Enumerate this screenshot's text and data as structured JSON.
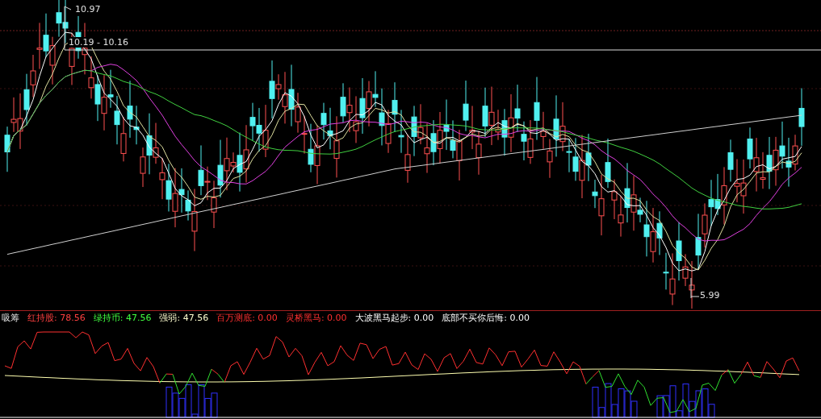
{
  "price_labels": [
    {
      "text": "10.97"
    },
    {
      "text": "10.19 - 10.16"
    },
    {
      "text": "5.99"
    }
  ],
  "indicator": {
    "title": "吸筹",
    "items": [
      {
        "label": "红持股:",
        "value": "78.56",
        "color": "#ff4040"
      },
      {
        "label": "绿持币:",
        "value": "47.56",
        "color": "#40ff40"
      },
      {
        "label": "强弱:",
        "value": "47.56",
        "color": "#ffffd0"
      },
      {
        "label": "百万测底:",
        "value": "0.00",
        "color": "#ff3030"
      },
      {
        "label": "灵桥黑马:",
        "value": "0.00",
        "color": "#ff3030"
      },
      {
        "label": "大波黑马起步:",
        "value": "0.00",
        "color": "#ffffff"
      },
      {
        "label": "底部不买你后悔:",
        "value": "0.00",
        "color": "#ffffff"
      }
    ]
  }
}
